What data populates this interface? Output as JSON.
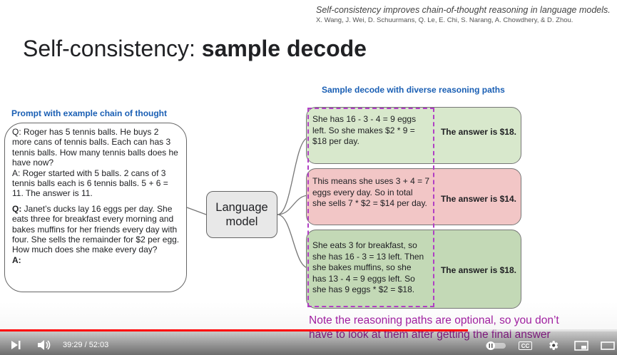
{
  "citation": {
    "title": "Self-consistency improves chain-of-thought reasoning in language models.",
    "authors": "X. Wang, J. Wei, D. Schuurmans, Q. Le, E. Chi, S. Narang, A. Chowdhery, & D. Zhou."
  },
  "slide": {
    "title_plain": "Self-consistency: ",
    "title_bold": "sample decode",
    "sample_heading": "Sample decode with diverse reasoning paths",
    "prompt_heading": "Prompt with example chain of thought",
    "prompt": {
      "example": "Q: Roger has 5 tennis balls. He buys 2 more cans of tennis balls. Each can has 3 tennis balls. How many tennis balls does he have now?\nA: Roger started with 5 balls. 2 cans of 3 tennis balls each is 6 tennis balls. 5 + 6 = 11. The answer is 11.",
      "question_label": "Q:",
      "question": " Janet’s ducks lay 16 eggs per day. She eats three for breakfast every morning and bakes muffins for her friends every day with four. She sells the remainder for $2 per egg. How much does she make every day?",
      "answer_label": "A:"
    },
    "model_label": "Language\nmodel",
    "paths": [
      {
        "text": "She has 16 - 3 - 4 = 9 eggs\nleft. So she makes $2 * 9 =\n$18 per day.",
        "answer": "The answer is $18.",
        "color": "#d8e8cc"
      },
      {
        "text": "This means she uses 3 + 4 = 7\neggs every day. So in total\nshe sells 7 * $2 = $14 per day.",
        "answer": "The answer is $14.",
        "color": "#f2c6c6"
      },
      {
        "text": "She eats 3 for breakfast, so\nshe has 16 - 3 = 13 left. Then\nshe bakes muffins, so she\nhas 13 - 4 = 9 eggs left. So\nshe has 9 eggs * $2 = $18.",
        "answer": "The answer is $18.",
        "color": "#c3d9b6"
      }
    ],
    "note": "Note the reasoning paths are optional, so you don’t\nhave to look at them after getting the final answer"
  },
  "player": {
    "current_time": "39:29",
    "separator": " / ",
    "duration": "52:03",
    "progress": 0.7586,
    "cc_label": "CC",
    "accent_color": "#ff0000"
  }
}
